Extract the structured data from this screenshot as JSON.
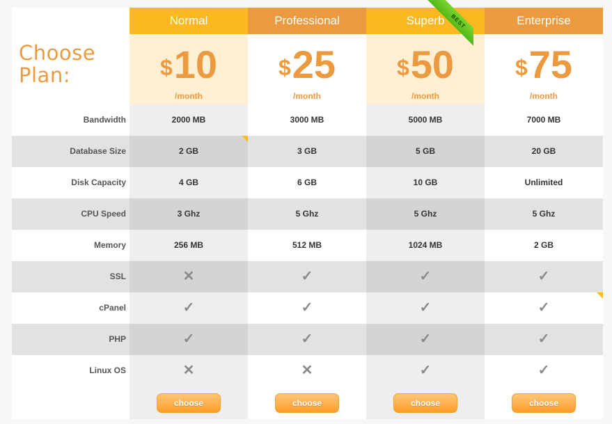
{
  "title": "Choose Plan:",
  "features": [
    "Bandwidth",
    "Database Size",
    "Disk Capacity",
    "CPU Speed",
    "Memory",
    "SSL",
    "cPanel",
    "PHP",
    "Linux OS"
  ],
  "plans": [
    {
      "name": "Normal",
      "currency": "$",
      "price": "10",
      "period": "/month",
      "button": "choose",
      "values": [
        "2000 MB",
        "2 GB",
        "4 GB",
        "3 Ghz",
        "256 MB",
        "✕",
        "✓",
        "✓",
        "✕"
      ]
    },
    {
      "name": "Professional",
      "currency": "$",
      "price": "25",
      "period": "/month",
      "button": "choose",
      "values": [
        "3000 MB",
        "3 GB",
        "6 GB",
        "5 Ghz",
        "512 MB",
        "✓",
        "✓",
        "✓",
        "✕"
      ]
    },
    {
      "name": "Superb",
      "currency": "$",
      "price": "50",
      "period": "/month",
      "button": "choose",
      "badge": "BEST",
      "values": [
        "5000 MB",
        "5 GB",
        "10 GB",
        "5 Ghz",
        "1024 MB",
        "✓",
        "✓",
        "✓",
        "✓"
      ]
    },
    {
      "name": "Enterprise",
      "currency": "$",
      "price": "75",
      "period": "/month",
      "button": "choose",
      "values": [
        "7000 MB",
        "20 GB",
        "Unlimited",
        "5 Ghz",
        "2 GB",
        "✓",
        "✓",
        "✓",
        "✓"
      ]
    }
  ],
  "colors": {
    "accent": "#ec9a40",
    "header_yellow": "#fbb820",
    "header_orange": "#ec9a40",
    "ribbon": "#5cc21e"
  }
}
